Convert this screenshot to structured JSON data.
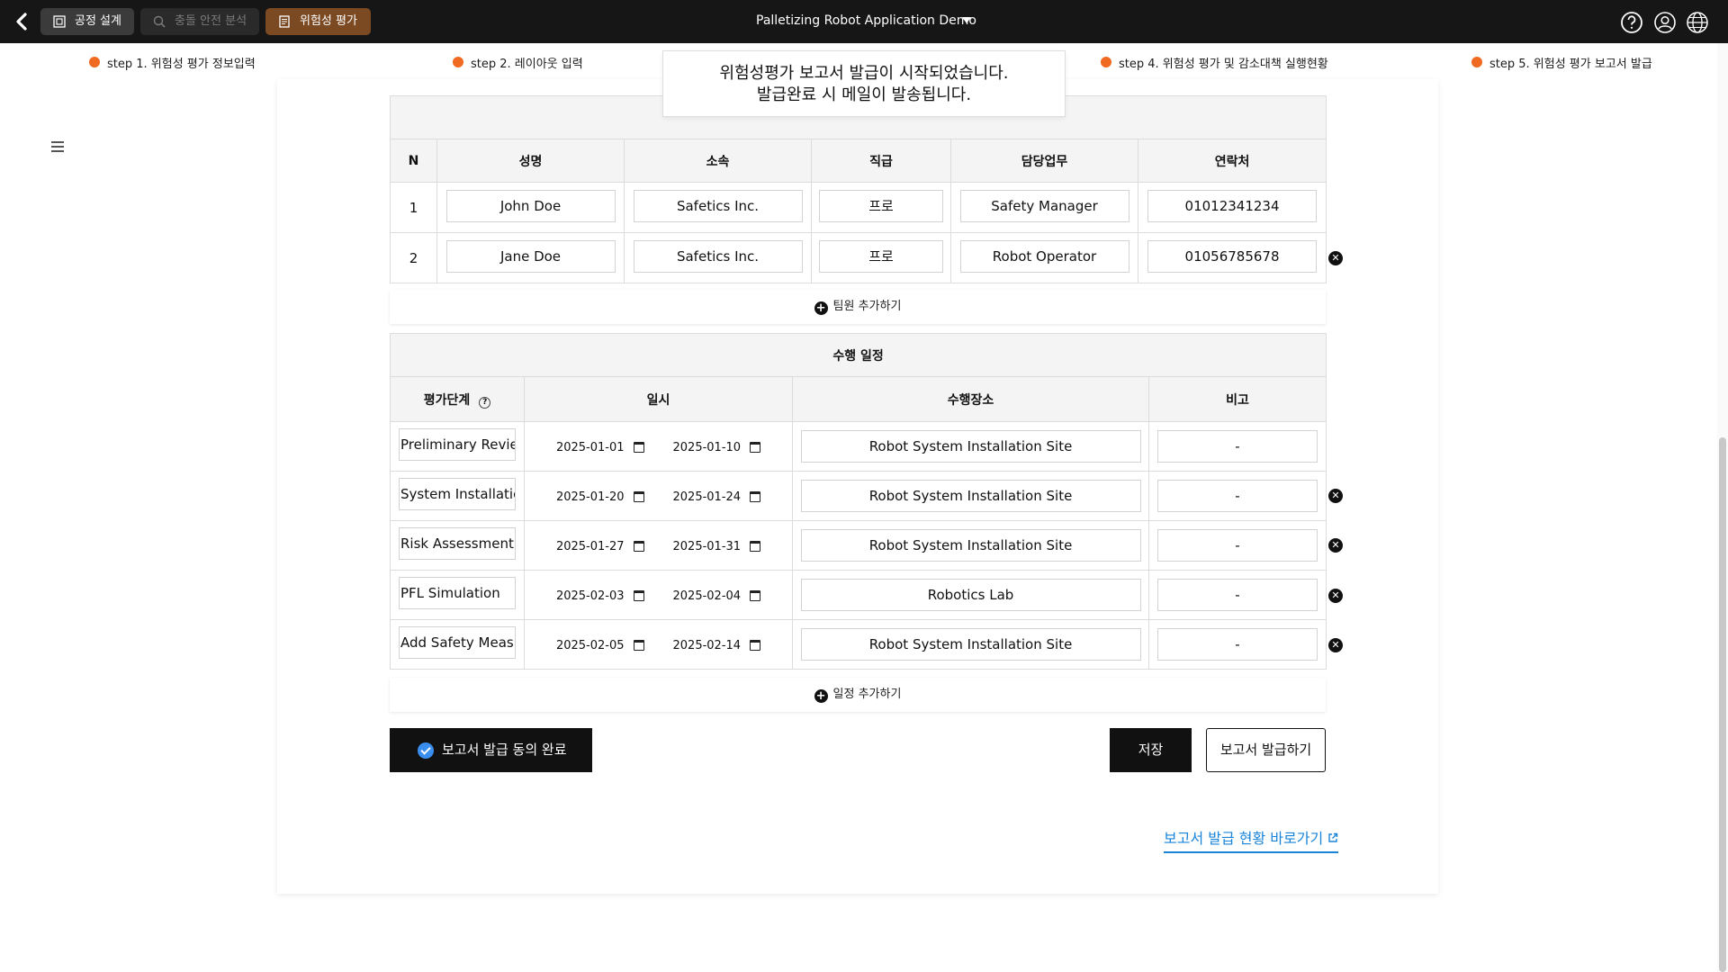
{
  "topbar": {
    "tabs": [
      {
        "label": "공정 설계"
      },
      {
        "label": "충돌 안전 분석"
      },
      {
        "label": "위험성 평가"
      }
    ],
    "app_title": "Palletizing Robot Application Demo",
    "icons": [
      "help-icon",
      "user-icon",
      "globe-icon"
    ]
  },
  "steps": [
    "step 1. 위험성 평가 정보입력",
    "step 2. 레이아웃 입력",
    "step 4. 위험성 평가 및 감소대책 실행현황",
    "step 5. 위험성 평가 보고서 발급"
  ],
  "toast": {
    "line1": "위험성평가 보고서 발급이 시작되었습니다.",
    "line2": "발급완료 시 메일이 발송됩니다."
  },
  "team": {
    "headers": [
      "N",
      "성명",
      "소속",
      "직급",
      "담당업무",
      "연락처"
    ],
    "rows": [
      {
        "n": "1",
        "name": "John Doe",
        "org": "Safetics Inc.",
        "rank": "프로",
        "duty": "Safety Manager",
        "phone": "01012341234"
      },
      {
        "n": "2",
        "name": "Jane Doe",
        "org": "Safetics Inc.",
        "rank": "프로",
        "duty": "Robot Operator",
        "phone": "01056785678"
      }
    ],
    "add_label": "팀원 추가하기"
  },
  "schedule": {
    "caption": "수행 일정",
    "headers": [
      "평가단계",
      "일시",
      "수행장소",
      "비고"
    ],
    "rows": [
      {
        "stage": "Preliminary Review",
        "start": "2025-01-01",
        "end": "2025-01-10",
        "place": "Robot System Installation Site",
        "note": "-"
      },
      {
        "stage": "System Installation",
        "start": "2025-01-20",
        "end": "2025-01-24",
        "place": "Robot System Installation Site",
        "note": "-"
      },
      {
        "stage": "Risk Assessment",
        "start": "2025-01-27",
        "end": "2025-01-31",
        "place": "Robot System Installation Site",
        "note": "-"
      },
      {
        "stage": "PFL Simulation",
        "start": "2025-02-03",
        "end": "2025-02-04",
        "place": "Robotics Lab",
        "note": "-"
      },
      {
        "stage": "Add Safety Measures",
        "start": "2025-02-05",
        "end": "2025-02-14",
        "place": "Robot System Installation Site",
        "note": "-"
      }
    ],
    "add_label": "일정 추가하기"
  },
  "actions": {
    "consent": "보고서 발급 동의 완료",
    "save": "저장",
    "issue": "보고서 발급하기",
    "status_link": "보고서 발급 현황 바로가기"
  },
  "colors": {
    "topbar": "#161616",
    "active_tab": "#7b4a23",
    "step_dot": "#f06a22",
    "consent_check": "#3a8ef0",
    "link": "#1a84d8"
  }
}
